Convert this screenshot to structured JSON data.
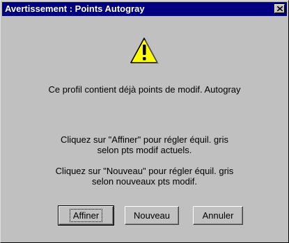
{
  "window": {
    "title": "Avertissement : Points Autogray"
  },
  "icons": {
    "warning": "warning-triangle-icon",
    "close": "close-icon"
  },
  "colors": {
    "titlebar": "#000080",
    "dialog_bg": "#c0c0c0",
    "warning_fill": "#ffff00"
  },
  "message": {
    "main": "Ce profil contient déjà points de modif. Autogray",
    "affiner_line1": "Cliquez sur \"Affiner\" pour régler équil. gris",
    "affiner_line2": "selon pts modif actuels.",
    "nouveau_line1": "Cliquez sur \"Nouveau\" pour régler équil. gris",
    "nouveau_line2": "selon nouveaux pts modif."
  },
  "buttons": {
    "affiner": "Affiner",
    "nouveau": "Nouveau",
    "annuler": "Annuler"
  }
}
